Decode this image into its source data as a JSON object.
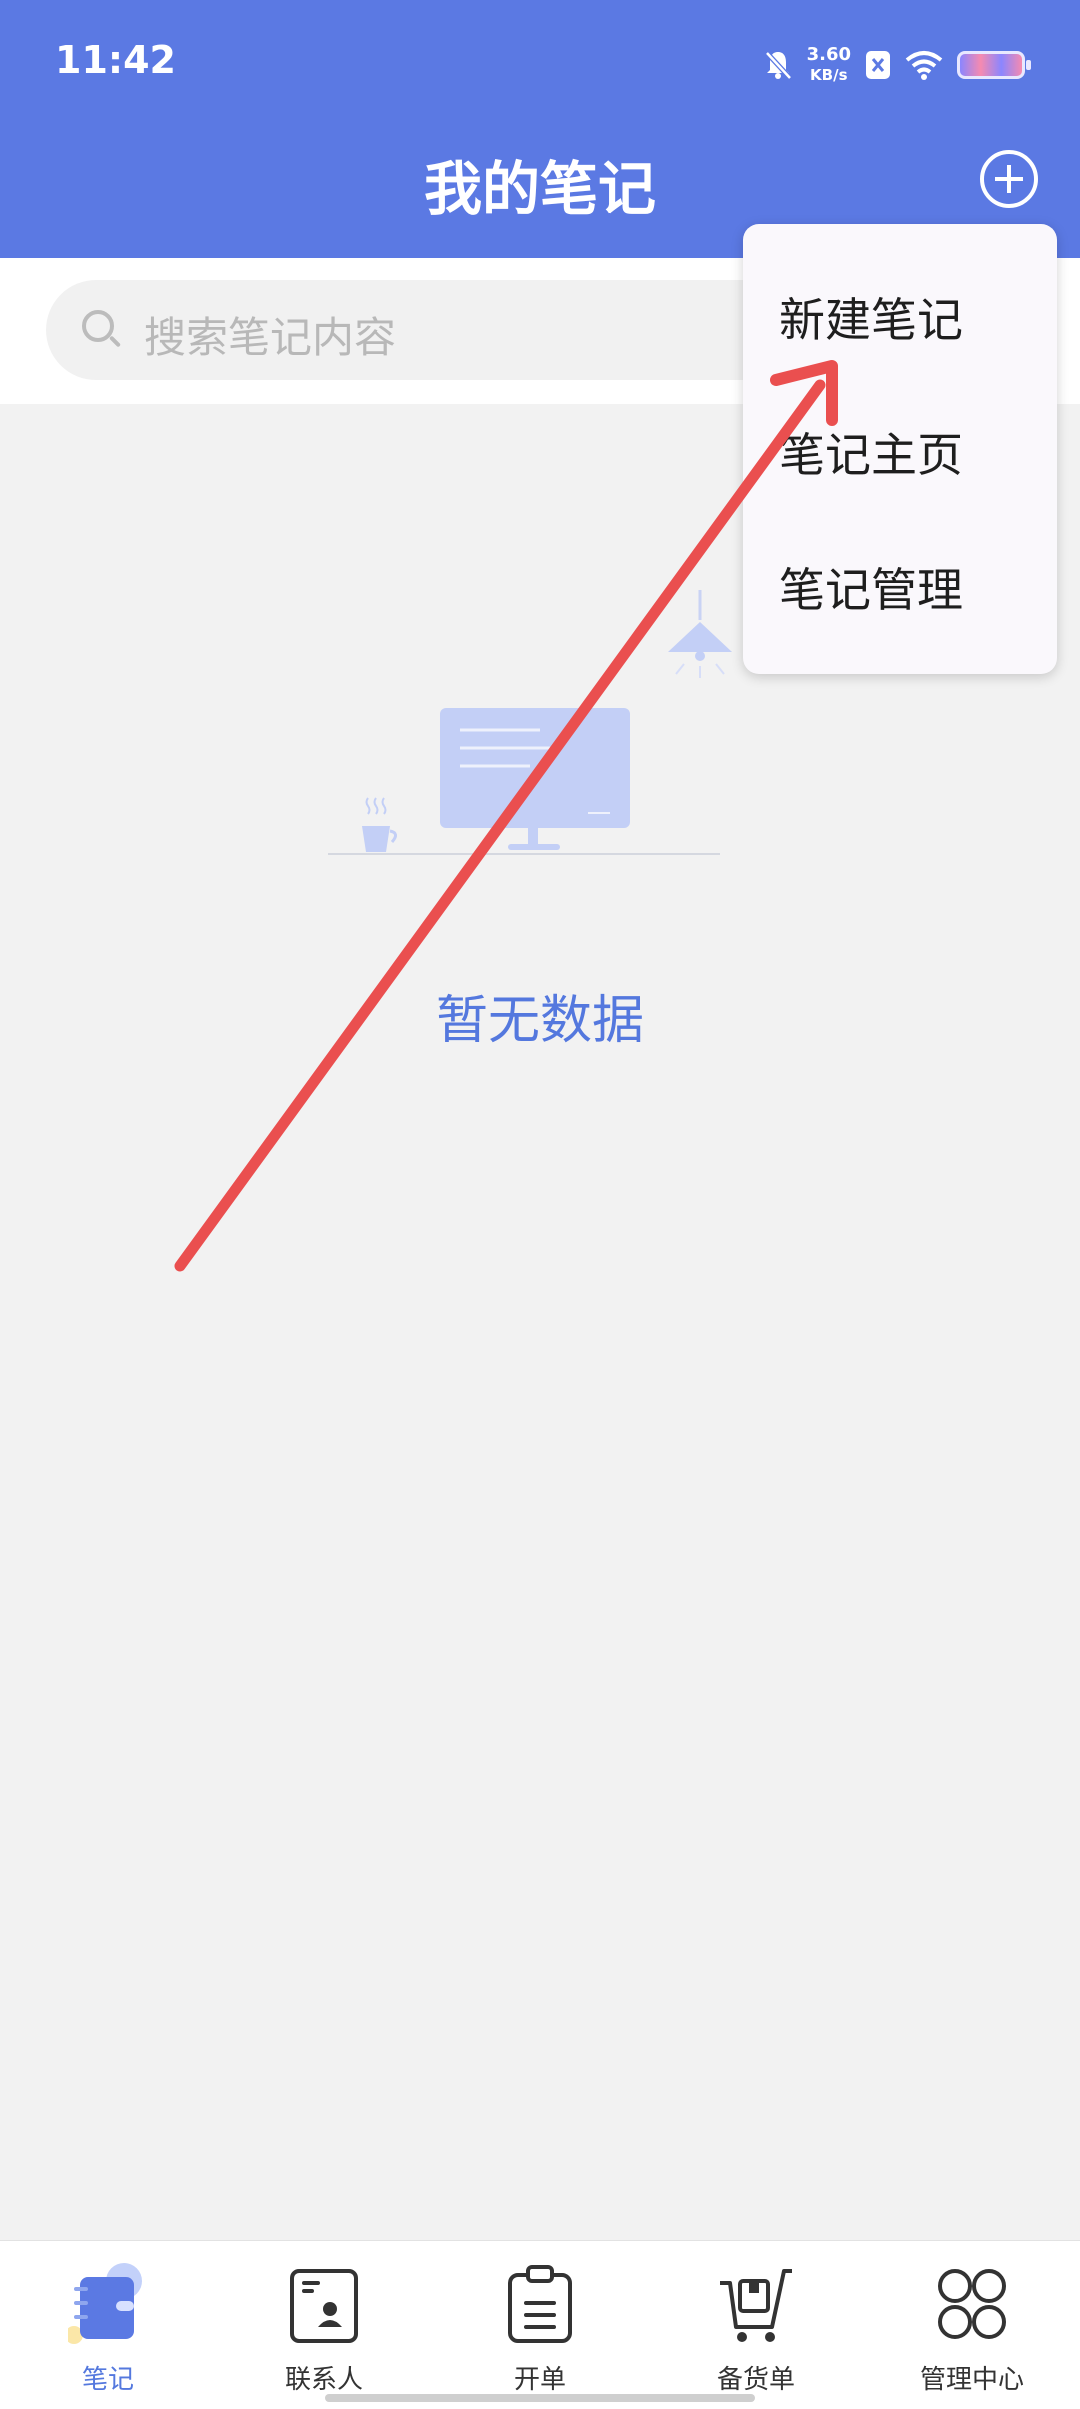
{
  "status_bar": {
    "time": "11:42",
    "speed_value": "3.60",
    "speed_unit": "KB/s"
  },
  "header": {
    "title": "我的笔记",
    "add_icon": "plus-circle-icon"
  },
  "search": {
    "placeholder": "搜索笔记内容"
  },
  "empty_state": {
    "message": "暂无数据"
  },
  "popup_menu": {
    "items": [
      "新建笔记",
      "笔记主页",
      "笔记管理"
    ]
  },
  "tabbar": {
    "active_color": "#5478de",
    "items": [
      {
        "label": "笔记",
        "icon": "notebook-icon",
        "active": true
      },
      {
        "label": "联系人",
        "icon": "contact-card-icon",
        "active": false
      },
      {
        "label": "开单",
        "icon": "clipboard-icon",
        "active": false
      },
      {
        "label": "备货单",
        "icon": "cart-icon",
        "active": false
      },
      {
        "label": "管理中心",
        "icon": "grid-icon",
        "active": false
      }
    ]
  },
  "colors": {
    "header_bg": "#5b79e3",
    "accent": "#5478de",
    "annotation_arrow": "#ea4f4f"
  }
}
